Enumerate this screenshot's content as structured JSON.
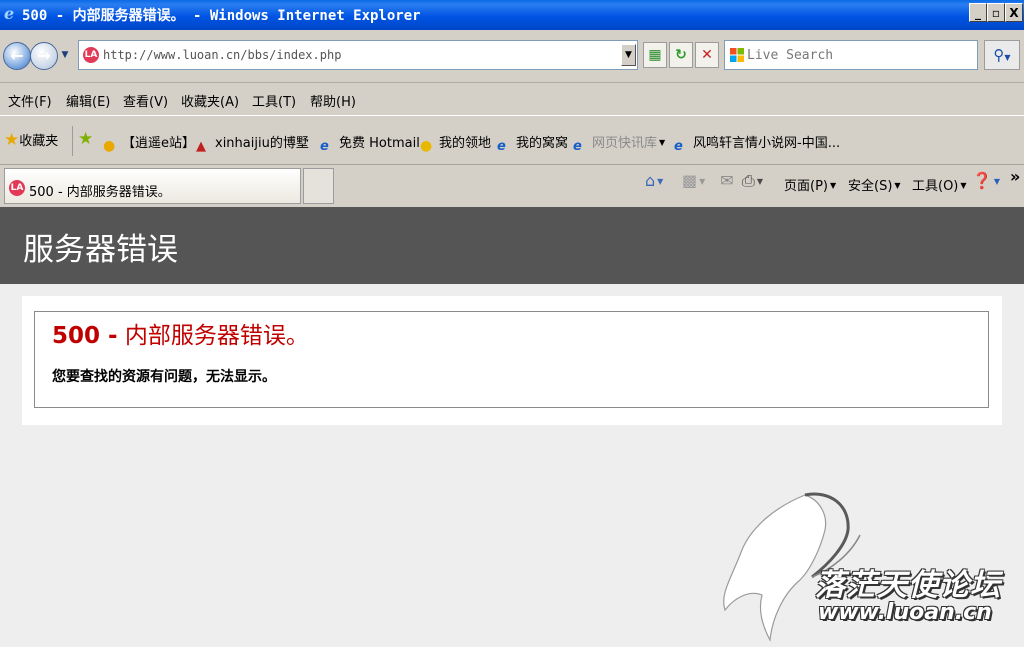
{
  "window": {
    "title": "500 - 内部服务器错误。 - Windows Internet Explorer",
    "minimize": "_",
    "restore": "▫",
    "close": "X"
  },
  "address": {
    "url": "http://www.luoan.cn/bbs/index.php",
    "site_icon_letter": "LA"
  },
  "search": {
    "placeholder": "Live Search"
  },
  "menu": {
    "items": [
      "文件(F)",
      "编辑(E)",
      "查看(V)",
      "收藏夹(A)",
      "工具(T)",
      "帮助(H)"
    ]
  },
  "favorites": {
    "label": "收藏夹",
    "items": [
      "【逍遥e站】",
      "xinhaijiu的博墅",
      "免费 Hotmail",
      "我的领地",
      "我的窝窝",
      "网页快讯库",
      "风鸣轩言情小说网-中国..."
    ]
  },
  "tabs": {
    "active_title": "500 - 内部服务器错误。"
  },
  "commandbar": {
    "page": "页面(P)",
    "safety": "安全(S)",
    "tools": "工具(O)",
    "more": "»"
  },
  "error_page": {
    "header": "服务器错误",
    "code": "500 -",
    "title": "内部服务器错误。",
    "message": "您要查找的资源有问题，无法显示。"
  },
  "watermark": {
    "line1": "落茫天使论坛",
    "line2": "www.luoan.cn"
  },
  "colors": {
    "header_bg": "#555555",
    "error_red": "#c00000",
    "titlebar_blue": "#0054e3"
  }
}
